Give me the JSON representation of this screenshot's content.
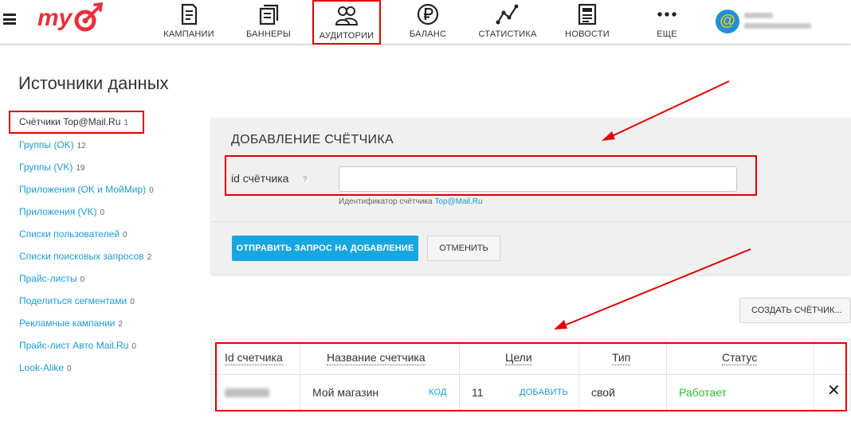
{
  "topnav": {
    "logo_text": "my",
    "items": [
      {
        "label": "КАМПАНИИ",
        "icon": "campaigns-doc-icon"
      },
      {
        "label": "БАННЕРЫ",
        "icon": "banners-doc-icon"
      },
      {
        "label": "АУДИТОРИИ",
        "icon": "audience-people-icon"
      },
      {
        "label": "БАЛАНС",
        "icon": "ruble-coin-icon"
      },
      {
        "label": "СТАТИСТИКА",
        "icon": "stats-line-icon"
      },
      {
        "label": "НОВОСТИ",
        "icon": "news-doc-icon"
      },
      {
        "label": "ЕЩЕ",
        "icon": "more-dots-icon"
      }
    ],
    "active_index": 2
  },
  "page": {
    "title": "Источники данных"
  },
  "sidebar": {
    "items": [
      {
        "label": "Счётчики Top@Mail.Ru",
        "count": "1"
      },
      {
        "label": "Группы (OK)",
        "count": "12"
      },
      {
        "label": "Группы (VK)",
        "count": "19"
      },
      {
        "label": "Приложения (OK и МойМир)",
        "count": "0"
      },
      {
        "label": "Приложения (VK)",
        "count": "0"
      },
      {
        "label": "Списки пользователей",
        "count": "0"
      },
      {
        "label": "Списки поисковых запросов",
        "count": "2"
      },
      {
        "label": "Прайс-листы",
        "count": "0"
      },
      {
        "label": "Поделиться сегментами",
        "count": "0"
      },
      {
        "label": "Рекламные кампании",
        "count": "2"
      },
      {
        "label": "Прайс-лист Авто Mail.Ru",
        "count": "0"
      },
      {
        "label": "Look-Alike",
        "count": "0"
      }
    ],
    "active_index": 0
  },
  "add_counter": {
    "title": "ДОБАВЛЕНИЕ СЧЁТЧИКА",
    "field_label": "id счётчика",
    "help_mark": "?",
    "field_value": "",
    "hint_prefix": "Идентификатор счётчика",
    "hint_link": "Top@Mail.Ru",
    "submit_label": "ОТПРАВИТЬ ЗАПРОС НА ДОБАВЛЕНИЕ",
    "cancel_label": "ОТМЕНИТЬ"
  },
  "create_button_label": "СОЗДАТЬ СЧЁТЧИК...",
  "table": {
    "headers": [
      "Id счетчика",
      "Название счетчика",
      "Цели",
      "Тип",
      "Статус"
    ],
    "rows": [
      {
        "name": "Мой магазин",
        "name_action": "КОД",
        "goals": "11",
        "goals_action": "ДОБАВИТЬ",
        "type": "свой",
        "status": "Работает",
        "close": "✕"
      }
    ]
  },
  "colors": {
    "accent_blue": "#18a6e0",
    "link_blue": "#1a9bd7",
    "status_green": "#2eb82e",
    "annotation_red": "#e10000",
    "logo_red": "#e8303a"
  }
}
